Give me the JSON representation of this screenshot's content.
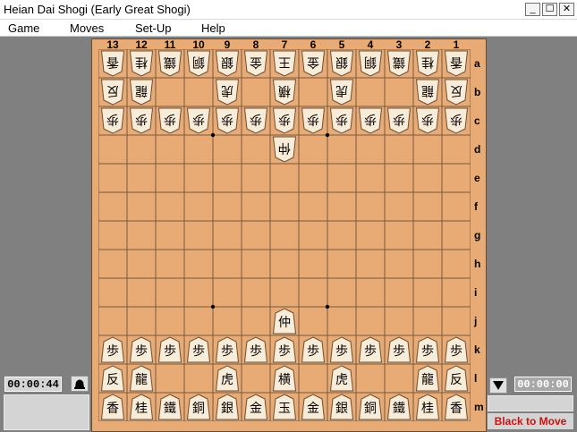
{
  "window": {
    "title": "Heian Dai Shogi (Early Great Shogi)",
    "minimize": "_",
    "maximize": "☐",
    "close": "✕"
  },
  "menu": [
    "Game",
    "Moves",
    "Set-Up",
    "Help"
  ],
  "board": {
    "files": [
      "13",
      "12",
      "11",
      "10",
      "9",
      "8",
      "7",
      "6",
      "5",
      "4",
      "3",
      "2",
      "1"
    ],
    "ranks": [
      "a",
      "b",
      "c",
      "d",
      "e",
      "f",
      "g",
      "h",
      "i",
      "j",
      "k",
      "l",
      "m"
    ],
    "empty_symbol": ".",
    "rows": [
      [
        "香",
        "桂",
        "鐵",
        "銅",
        "銀",
        "金",
        "王",
        "金",
        "銀",
        "銅",
        "鐵",
        "桂",
        "香"
      ],
      [
        "反",
        "龍",
        ".",
        ".",
        "虎",
        ".",
        "横",
        ".",
        "虎",
        ".",
        ".",
        "龍",
        "反"
      ],
      [
        "歩",
        "歩",
        "歩",
        "歩",
        "歩",
        "歩",
        "歩",
        "歩",
        "歩",
        "歩",
        "歩",
        "歩",
        "歩"
      ],
      [
        ".",
        ".",
        ".",
        ".",
        ".",
        ".",
        "仲",
        ".",
        ".",
        ".",
        ".",
        ".",
        "."
      ],
      [
        ".",
        ".",
        ".",
        ".",
        ".",
        ".",
        ".",
        ".",
        ".",
        ".",
        ".",
        ".",
        "."
      ],
      [
        ".",
        ".",
        ".",
        ".",
        ".",
        ".",
        ".",
        ".",
        ".",
        ".",
        ".",
        ".",
        "."
      ],
      [
        ".",
        ".",
        ".",
        ".",
        ".",
        ".",
        ".",
        ".",
        ".",
        ".",
        ".",
        ".",
        "."
      ],
      [
        ".",
        ".",
        ".",
        ".",
        ".",
        ".",
        ".",
        ".",
        ".",
        ".",
        ".",
        ".",
        "."
      ],
      [
        ".",
        ".",
        ".",
        ".",
        ".",
        ".",
        ".",
        ".",
        ".",
        ".",
        ".",
        ".",
        "."
      ],
      [
        ".",
        ".",
        ".",
        ".",
        ".",
        ".",
        "仲",
        ".",
        ".",
        ".",
        ".",
        ".",
        "."
      ],
      [
        "歩",
        "歩",
        "歩",
        "歩",
        "歩",
        "歩",
        "歩",
        "歩",
        "歩",
        "歩",
        "歩",
        "歩",
        "歩"
      ],
      [
        "反",
        "龍",
        ".",
        ".",
        "虎",
        ".",
        "横",
        ".",
        "虎",
        ".",
        ".",
        "龍",
        "反"
      ],
      [
        "香",
        "桂",
        "鐵",
        "銅",
        "銀",
        "金",
        "玉",
        "金",
        "銀",
        "銅",
        "鐵",
        "桂",
        "香"
      ]
    ],
    "gote_ranks": 4,
    "hoshi": [
      [
        3,
        4
      ],
      [
        3,
        8
      ],
      [
        9,
        4
      ],
      [
        9,
        8
      ]
    ],
    "colors": {
      "square": "#e8ab76",
      "line": "#7a5a3c",
      "piece": "#f8ecd8",
      "piece_border": "#6a5038"
    }
  },
  "left": {
    "clock": "00:00:44",
    "button_icon": "bell-icon"
  },
  "right": {
    "clock": "00:00:00",
    "button_icon": "triangle-down-icon"
  },
  "status": {
    "text": "Black to Move",
    "color": "#d01010"
  }
}
